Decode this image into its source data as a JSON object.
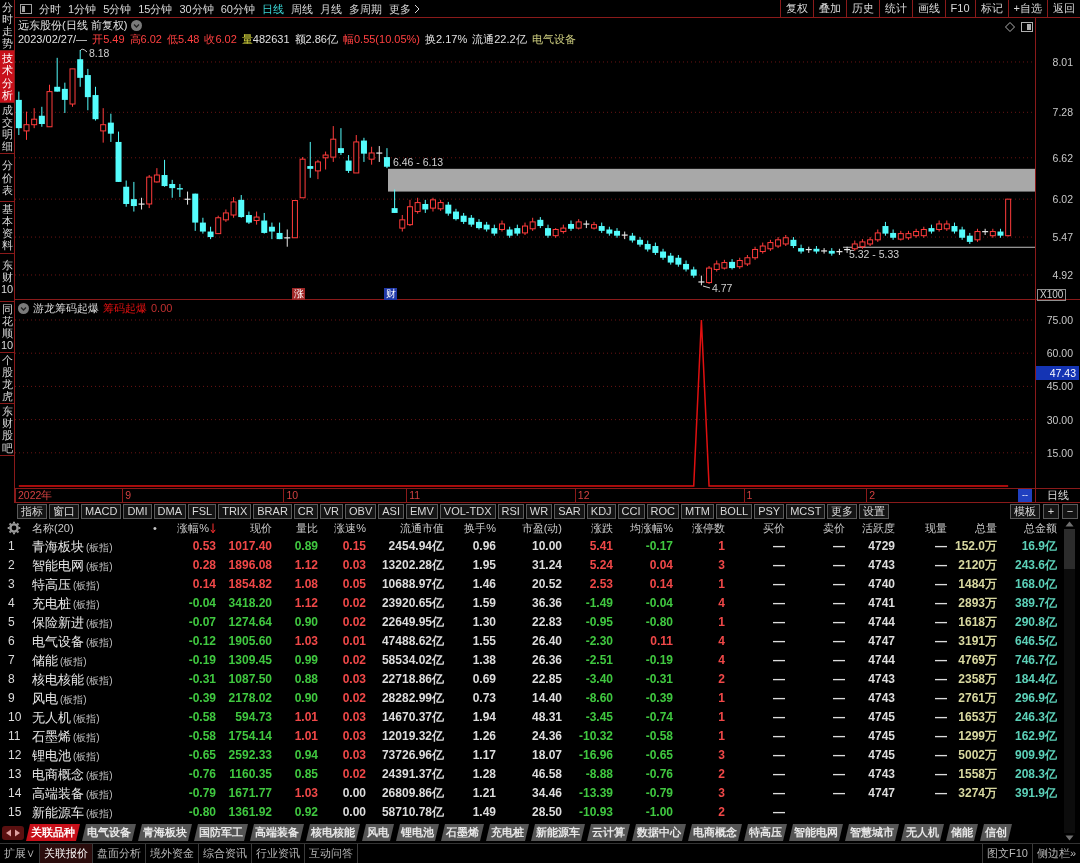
{
  "sidebar": {
    "tabs": [
      {
        "label": "分时走势",
        "selected": false
      },
      {
        "label": "技术分析",
        "selected": true
      },
      {
        "label": "成交明细",
        "selected": false
      },
      {
        "label": "分价表",
        "selected": false
      },
      {
        "label": "基本资料",
        "selected": false
      },
      {
        "label": "东财10",
        "selected": false
      },
      {
        "label": "同花顺10",
        "selected": false
      },
      {
        "label": "个股龙虎",
        "selected": false
      },
      {
        "label": "东财股吧",
        "selected": false
      }
    ]
  },
  "toolbar": {
    "period_tabs": [
      {
        "label": "分时",
        "kind": "period",
        "selected": false
      },
      {
        "label": "1分钟",
        "kind": "period",
        "selected": false
      },
      {
        "label": "5分钟",
        "kind": "period",
        "selected": false
      },
      {
        "label": "15分钟",
        "kind": "period",
        "selected": false
      },
      {
        "label": "30分钟",
        "kind": "period",
        "selected": false
      },
      {
        "label": "60分钟",
        "kind": "period",
        "selected": false
      },
      {
        "label": "日线",
        "kind": "period",
        "selected": true
      },
      {
        "label": "周线",
        "kind": "period",
        "selected": false
      },
      {
        "label": "月线",
        "kind": "period",
        "selected": false
      },
      {
        "label": "多周期",
        "kind": "period",
        "selected": false
      },
      {
        "label": "更多",
        "kind": "menu",
        "selected": false
      }
    ],
    "buttons": [
      "复权",
      "叠加",
      "历史",
      "统计",
      "画线",
      "F10",
      "标记",
      "+自选",
      "返回"
    ]
  },
  "price_chart": {
    "title": "远东股份(日线 前复权)",
    "quote": {
      "date": "2023/02/27/—",
      "fields": [
        {
          "label": "开",
          "value": "5.49",
          "kind": "quote",
          "rising": true
        },
        {
          "label": "高",
          "value": "6.02",
          "kind": "quote",
          "rising": true
        },
        {
          "label": "低",
          "value": "5.48",
          "kind": "quote",
          "rising": true
        },
        {
          "label": "收",
          "value": "6.02",
          "kind": "quote",
          "rising": true
        },
        {
          "label": "量",
          "value": "482631",
          "kind": "volume",
          "rising": false
        },
        {
          "label": "额",
          "value": "2.86亿",
          "kind": "quote",
          "rising": false
        },
        {
          "label": "幅",
          "value": "0.55(10.05%)",
          "kind": "quote",
          "rising": true
        },
        {
          "label": "换",
          "value": "2.17%",
          "kind": "quote",
          "rising": false
        },
        {
          "label": "流通",
          "value": "22.2亿",
          "kind": "quote",
          "rising": false
        }
      ],
      "sector": "电气设备"
    },
    "scale_label": "X100",
    "annotations": [
      {
        "kind": "high",
        "text": "8.18"
      },
      {
        "kind": "low",
        "text": "4.77"
      }
    ],
    "markers": [
      {
        "text": "涨",
        "color": "#a02828"
      },
      {
        "text": "财",
        "color": "#2038a8"
      }
    ],
    "chart_data": {
      "type": "candlestick",
      "ylim": [
        4.557,
        8.648
      ],
      "yticks": [
        {
          "value": 8.01,
          "label": "8.01"
        },
        {
          "value": 7.28,
          "label": "7.28"
        },
        {
          "value": 6.62,
          "label": "6.62"
        },
        {
          "value": 6.02,
          "label": "6.02"
        },
        {
          "value": 5.47,
          "label": "5.47"
        },
        {
          "value": 4.92,
          "label": "4.92"
        }
      ],
      "grid": true,
      "bands": [
        {
          "axis": "y",
          "from": 6.13,
          "to": 6.46,
          "label": "6.46 - 6.13",
          "color": "#a8a8a8"
        },
        {
          "axis": "y",
          "from": 5.32,
          "to": 5.33,
          "label": "5.32 - 5.33",
          "color": "#a0a0a0"
        }
      ],
      "ohlc": [
        [
          7.46,
          7.58,
          6.95,
          7.05
        ],
        [
          7.01,
          7.29,
          6.88,
          7.1
        ],
        [
          7.1,
          7.34,
          7.05,
          7.18
        ],
        [
          7.23,
          7.36,
          7.07,
          7.11
        ],
        [
          7.07,
          7.68,
          7.07,
          7.58
        ],
        [
          7.65,
          8.07,
          7.58,
          7.58
        ],
        [
          7.62,
          7.71,
          7.27,
          7.46
        ],
        [
          7.4,
          7.91,
          7.36,
          7.91
        ],
        [
          8.05,
          8.18,
          7.65,
          7.78
        ],
        [
          7.82,
          7.91,
          7.31,
          7.5
        ],
        [
          7.53,
          7.65,
          7.16,
          7.18
        ],
        [
          7.01,
          7.34,
          6.84,
          7.1
        ],
        [
          7.13,
          7.26,
          6.85,
          6.97
        ],
        [
          6.85,
          7.0,
          6.27,
          6.27
        ],
        [
          6.2,
          6.29,
          5.91,
          5.95
        ],
        [
          6.02,
          6.27,
          5.84,
          5.92
        ],
        [
          5.95,
          6.04,
          5.87,
          5.95
        ],
        [
          5.95,
          6.37,
          5.89,
          6.34
        ],
        [
          6.27,
          6.47,
          6.26,
          6.37
        ],
        [
          6.37,
          6.59,
          6.2,
          6.21
        ],
        [
          6.24,
          6.3,
          6.04,
          6.18
        ],
        [
          6.18,
          6.24,
          6.05,
          6.16
        ],
        [
          6.02,
          6.13,
          5.94,
          6.02
        ],
        [
          6.1,
          6.1,
          5.56,
          5.68
        ],
        [
          5.68,
          5.75,
          5.52,
          5.55
        ],
        [
          5.55,
          5.62,
          5.44,
          5.47
        ],
        [
          5.52,
          5.78,
          5.52,
          5.75
        ],
        [
          5.72,
          5.87,
          5.69,
          5.82
        ],
        [
          5.79,
          6.05,
          5.75,
          5.98
        ],
        [
          6.01,
          6.08,
          5.75,
          5.76
        ],
        [
          5.79,
          5.84,
          5.66,
          5.68
        ],
        [
          5.71,
          5.84,
          5.65,
          5.76
        ],
        [
          5.71,
          5.82,
          5.52,
          5.53
        ],
        [
          5.62,
          5.68,
          5.44,
          5.55
        ],
        [
          5.53,
          5.68,
          5.44,
          5.44
        ],
        [
          5.46,
          5.58,
          5.33,
          5.46
        ],
        [
          5.46,
          6.0,
          5.46,
          6.0
        ],
        [
          6.04,
          6.63,
          6.04,
          6.6
        ],
        [
          6.5,
          6.85,
          6.33,
          6.46
        ],
        [
          6.43,
          6.59,
          6.31,
          6.56
        ],
        [
          6.62,
          6.71,
          6.45,
          6.66
        ],
        [
          6.63,
          7.08,
          6.56,
          6.89
        ],
        [
          6.76,
          7.05,
          6.66,
          6.69
        ],
        [
          6.58,
          6.66,
          6.4,
          6.43
        ],
        [
          6.4,
          6.95,
          6.4,
          6.85
        ],
        [
          6.87,
          6.91,
          6.56,
          6.68
        ],
        [
          6.6,
          6.78,
          6.52,
          6.69
        ],
        [
          6.69,
          6.79,
          6.56,
          6.69
        ],
        [
          6.63,
          6.76,
          6.47,
          6.49
        ],
        [
          5.89,
          6.16,
          5.82,
          5.82
        ],
        [
          5.6,
          5.79,
          5.55,
          5.72
        ],
        [
          5.65,
          6.01,
          5.63,
          5.91
        ],
        [
          5.84,
          6.04,
          5.81,
          5.97
        ],
        [
          5.95,
          6.01,
          5.82,
          5.87
        ],
        [
          5.89,
          6.04,
          5.84,
          6.01
        ],
        [
          5.88,
          6.01,
          5.85,
          5.97
        ],
        [
          5.94,
          5.98,
          5.78,
          5.81
        ],
        [
          5.84,
          5.88,
          5.71,
          5.73
        ],
        [
          5.78,
          5.82,
          5.66,
          5.69
        ],
        [
          5.75,
          5.79,
          5.62,
          5.65
        ],
        [
          5.69,
          5.73,
          5.58,
          5.6
        ],
        [
          5.65,
          5.69,
          5.55,
          5.58
        ],
        [
          5.6,
          5.65,
          5.49,
          5.52
        ],
        [
          5.58,
          5.71,
          5.55,
          5.66
        ],
        [
          5.58,
          5.62,
          5.46,
          5.49
        ],
        [
          5.6,
          5.65,
          5.49,
          5.52
        ],
        [
          5.53,
          5.68,
          5.5,
          5.63
        ],
        [
          5.59,
          5.75,
          5.56,
          5.69
        ],
        [
          5.72,
          5.76,
          5.6,
          5.63
        ],
        [
          5.6,
          5.65,
          5.46,
          5.49
        ],
        [
          5.49,
          5.6,
          5.46,
          5.58
        ],
        [
          5.55,
          5.65,
          5.52,
          5.6
        ],
        [
          5.66,
          5.71,
          5.56,
          5.59
        ],
        [
          5.6,
          5.73,
          5.58,
          5.69
        ],
        [
          5.66,
          5.71,
          5.6,
          5.66
        ],
        [
          5.6,
          5.69,
          5.58,
          5.65
        ],
        [
          5.63,
          5.68,
          5.53,
          5.56
        ],
        [
          5.58,
          5.62,
          5.49,
          5.52
        ],
        [
          5.56,
          5.6,
          5.46,
          5.49
        ],
        [
          5.5,
          5.55,
          5.44,
          5.5
        ],
        [
          5.49,
          5.53,
          5.39,
          5.42
        ],
        [
          5.43,
          5.47,
          5.33,
          5.36
        ],
        [
          5.37,
          5.42,
          5.26,
          5.29
        ],
        [
          5.34,
          5.39,
          5.21,
          5.24
        ],
        [
          5.26,
          5.3,
          5.14,
          5.17
        ],
        [
          5.2,
          5.24,
          5.07,
          5.1
        ],
        [
          5.17,
          5.21,
          5.04,
          5.07
        ],
        [
          5.08,
          5.13,
          4.97,
          5.0
        ],
        [
          5.0,
          5.04,
          4.88,
          4.91
        ],
        [
          4.82,
          4.91,
          4.77,
          4.82
        ],
        [
          4.81,
          5.05,
          4.79,
          5.02
        ],
        [
          5.0,
          5.13,
          4.97,
          5.08
        ],
        [
          5.02,
          5.14,
          5.0,
          5.1
        ],
        [
          5.11,
          5.15,
          5.0,
          5.02
        ],
        [
          5.04,
          5.17,
          5.01,
          5.13
        ],
        [
          5.08,
          5.21,
          5.05,
          5.17
        ],
        [
          5.17,
          5.33,
          5.14,
          5.29
        ],
        [
          5.26,
          5.39,
          5.23,
          5.34
        ],
        [
          5.3,
          5.43,
          5.27,
          5.39
        ],
        [
          5.34,
          5.47,
          5.31,
          5.43
        ],
        [
          5.37,
          5.5,
          5.34,
          5.46
        ],
        [
          5.43,
          5.47,
          5.31,
          5.34
        ],
        [
          5.31,
          5.36,
          5.23,
          5.26
        ],
        [
          5.29,
          5.33,
          5.24,
          5.29
        ],
        [
          5.3,
          5.34,
          5.23,
          5.26
        ],
        [
          5.27,
          5.31,
          5.23,
          5.27
        ],
        [
          5.27,
          5.31,
          5.2,
          5.23
        ],
        [
          5.26,
          5.3,
          5.21,
          5.26
        ],
        [
          5.29,
          5.33,
          5.24,
          5.29
        ],
        [
          5.3,
          5.42,
          5.27,
          5.37
        ],
        [
          5.33,
          5.44,
          5.3,
          5.4
        ],
        [
          5.37,
          5.47,
          5.34,
          5.43
        ],
        [
          5.43,
          5.58,
          5.4,
          5.53
        ],
        [
          5.63,
          5.69,
          5.49,
          5.52
        ],
        [
          5.53,
          5.58,
          5.43,
          5.46
        ],
        [
          5.44,
          5.56,
          5.42,
          5.52
        ],
        [
          5.46,
          5.56,
          5.43,
          5.52
        ],
        [
          5.49,
          5.59,
          5.46,
          5.55
        ],
        [
          5.49,
          5.62,
          5.46,
          5.58
        ],
        [
          5.6,
          5.65,
          5.52,
          5.55
        ],
        [
          5.58,
          5.71,
          5.55,
          5.66
        ],
        [
          5.59,
          5.71,
          5.56,
          5.66
        ],
        [
          5.63,
          5.68,
          5.52,
          5.55
        ],
        [
          5.58,
          5.62,
          5.43,
          5.46
        ],
        [
          5.49,
          5.53,
          5.37,
          5.4
        ],
        [
          5.43,
          5.59,
          5.4,
          5.55
        ],
        [
          5.55,
          5.59,
          5.5,
          5.55
        ],
        [
          5.49,
          5.59,
          5.46,
          5.55
        ],
        [
          5.55,
          5.59,
          5.46,
          5.49
        ],
        [
          5.49,
          6.02,
          5.48,
          6.02
        ],
        null,
        null,
        null
      ]
    }
  },
  "indicator": {
    "value": "0.00",
    "cursor_value": "47.43",
    "chart_data": {
      "type": "line",
      "title": "游龙筹码起爆",
      "series": [
        {
          "name": "筹码起爆",
          "color": "#e01010",
          "values": [
            0,
            0,
            0,
            0,
            0,
            0,
            0,
            0,
            0,
            0,
            0,
            0,
            0,
            0,
            0,
            0,
            0,
            0,
            0,
            0,
            0,
            0,
            0,
            0,
            0,
            0,
            0,
            0,
            0,
            0,
            0,
            0,
            0,
            0,
            0,
            0,
            0,
            0,
            0,
            0,
            0,
            0,
            0,
            0,
            0,
            0,
            0,
            0,
            0,
            0,
            0,
            0,
            0,
            0,
            0,
            0,
            0,
            0,
            0,
            0,
            0,
            0,
            0,
            0,
            0,
            0,
            0,
            0,
            0,
            0,
            0,
            0,
            0,
            0,
            0,
            0,
            0,
            0,
            0,
            0,
            0,
            0,
            0,
            0,
            0,
            0,
            0,
            0,
            0,
            75,
            0,
            0,
            0,
            0,
            0,
            0,
            0,
            0,
            0,
            0,
            0,
            0,
            0,
            0,
            0,
            0,
            0,
            0,
            0,
            0,
            0,
            0,
            0,
            0,
            0,
            0,
            0,
            0,
            0,
            0,
            0,
            0,
            0,
            0,
            0,
            0,
            0,
            0,
            0,
            0,
            null,
            null,
            null
          ]
        }
      ],
      "ylim": [
        -0.9036,
        84.0359
      ],
      "yticks": [
        {
          "value": 15,
          "label": "15.00"
        },
        {
          "value": 30,
          "label": "30.00"
        },
        {
          "value": 45,
          "label": "45.00"
        },
        {
          "value": 60,
          "label": "60.00"
        },
        {
          "value": 75,
          "label": "75.00"
        }
      ],
      "grid": true
    }
  },
  "time_axis": {
    "labels": [
      "2022年",
      "9",
      "10",
      "11",
      "12",
      "1",
      "2"
    ],
    "cursor_date": "--",
    "period": "日线"
  },
  "indicator_tabs": {
    "items": [
      "指标",
      "窗口",
      "MACD",
      "DMI",
      "DMA",
      "FSL",
      "TRIX",
      "BRAR",
      "CR",
      "VR",
      "OBV",
      "ASI",
      "EMV",
      "VOL-TDX",
      "RSI",
      "WR",
      "SAR",
      "KDJ",
      "CCI",
      "ROC",
      "MTM",
      "BOLL",
      "PSY",
      "MCST",
      "更多",
      "设置"
    ],
    "right": [
      "模板",
      "+",
      "−"
    ]
  },
  "table": {
    "columns": [
      {
        "label": "名称(20)",
        "sorted": false
      },
      {
        "label": "•",
        "sorted": false
      },
      {
        "label": "涨幅%",
        "sorted": true
      },
      {
        "label": "现价",
        "sorted": false
      },
      {
        "label": "量比",
        "sorted": false
      },
      {
        "label": "涨速%",
        "sorted": false
      },
      {
        "label": "流通市值",
        "sorted": false
      },
      {
        "label": "换手%",
        "sorted": false
      },
      {
        "label": "市盈(动)",
        "sorted": false
      },
      {
        "label": "涨跌",
        "sorted": false
      },
      {
        "label": "均涨幅%",
        "sorted": false
      },
      {
        "label": "涨停数",
        "sorted": false
      },
      {
        "label": "买价",
        "sorted": false
      },
      {
        "label": "卖价",
        "sorted": false
      },
      {
        "label": "活跃度",
        "sorted": false
      },
      {
        "label": "现量",
        "sorted": false
      },
      {
        "label": "总量",
        "sorted": false
      },
      {
        "label": "总金额",
        "sorted": false
      }
    ],
    "rows": [
      {
        "no": "1",
        "name": "青海板块",
        "tag": "(板指)",
        "chg_pct": "0.53",
        "price": "1017.40",
        "vol_ratio": "0.89",
        "speed": "0.15",
        "float_cap": "2454.94亿",
        "turnover": "0.96",
        "pe": "10.00",
        "chg": "5.41",
        "avg_chg": "-0.17",
        "limit_up": "1",
        "bid": "—",
        "ask": "—",
        "activity": "4729",
        "cur_vol": "—",
        "total_vol": "152.0万",
        "amount": "16.9亿",
        "rising": true,
        "avg_rising": false,
        "ratio_high": false,
        "speed_rising": true
      },
      {
        "no": "2",
        "name": "智能电网",
        "tag": "(板指)",
        "chg_pct": "0.28",
        "price": "1896.08",
        "vol_ratio": "1.12",
        "speed": "0.03",
        "float_cap": "13202.28亿",
        "turnover": "1.95",
        "pe": "31.24",
        "chg": "5.24",
        "avg_chg": "0.04",
        "limit_up": "3",
        "bid": "—",
        "ask": "—",
        "activity": "4743",
        "cur_vol": "—",
        "total_vol": "2120万",
        "amount": "243.6亿",
        "rising": true,
        "avg_rising": true,
        "ratio_high": true,
        "speed_rising": true
      },
      {
        "no": "3",
        "name": "特高压",
        "tag": "(板指)",
        "chg_pct": "0.14",
        "price": "1854.82",
        "vol_ratio": "1.08",
        "speed": "0.05",
        "float_cap": "10688.97亿",
        "turnover": "1.46",
        "pe": "20.52",
        "chg": "2.53",
        "avg_chg": "0.14",
        "limit_up": "1",
        "bid": "—",
        "ask": "—",
        "activity": "4740",
        "cur_vol": "—",
        "total_vol": "1484万",
        "amount": "168.0亿",
        "rising": true,
        "avg_rising": true,
        "ratio_high": true,
        "speed_rising": true
      },
      {
        "no": "4",
        "name": "充电桩",
        "tag": "(板指)",
        "chg_pct": "-0.04",
        "price": "3418.20",
        "vol_ratio": "1.12",
        "speed": "0.02",
        "float_cap": "23920.65亿",
        "turnover": "1.59",
        "pe": "36.36",
        "chg": "-1.49",
        "avg_chg": "-0.04",
        "limit_up": "4",
        "bid": "—",
        "ask": "—",
        "activity": "4741",
        "cur_vol": "—",
        "total_vol": "2893万",
        "amount": "389.7亿",
        "rising": false,
        "avg_rising": false,
        "ratio_high": true,
        "speed_rising": true
      },
      {
        "no": "5",
        "name": "保险新进",
        "tag": "(板指)",
        "chg_pct": "-0.07",
        "price": "1274.64",
        "vol_ratio": "0.90",
        "speed": "0.02",
        "float_cap": "22649.95亿",
        "turnover": "1.30",
        "pe": "22.83",
        "chg": "-0.95",
        "avg_chg": "-0.80",
        "limit_up": "1",
        "bid": "—",
        "ask": "—",
        "activity": "4744",
        "cur_vol": "—",
        "total_vol": "1618万",
        "amount": "290.8亿",
        "rising": false,
        "avg_rising": false,
        "ratio_high": false,
        "speed_rising": true
      },
      {
        "no": "6",
        "name": "电气设备",
        "tag": "(板指)",
        "chg_pct": "-0.12",
        "price": "1905.60",
        "vol_ratio": "1.03",
        "speed": "0.01",
        "float_cap": "47488.62亿",
        "turnover": "1.55",
        "pe": "26.40",
        "chg": "-2.30",
        "avg_chg": "0.11",
        "limit_up": "4",
        "bid": "—",
        "ask": "—",
        "activity": "4747",
        "cur_vol": "—",
        "total_vol": "3191万",
        "amount": "646.5亿",
        "rising": false,
        "avg_rising": true,
        "ratio_high": true,
        "speed_rising": true
      },
      {
        "no": "7",
        "name": "储能",
        "tag": "(板指)",
        "chg_pct": "-0.19",
        "price": "1309.45",
        "vol_ratio": "0.99",
        "speed": "0.02",
        "float_cap": "58534.02亿",
        "turnover": "1.38",
        "pe": "26.36",
        "chg": "-2.51",
        "avg_chg": "-0.19",
        "limit_up": "4",
        "bid": "—",
        "ask": "—",
        "activity": "4744",
        "cur_vol": "—",
        "total_vol": "4769万",
        "amount": "746.7亿",
        "rising": false,
        "avg_rising": false,
        "ratio_high": false,
        "speed_rising": true
      },
      {
        "no": "8",
        "name": "核电核能",
        "tag": "(板指)",
        "chg_pct": "-0.31",
        "price": "1087.50",
        "vol_ratio": "0.88",
        "speed": "0.03",
        "float_cap": "22718.86亿",
        "turnover": "0.69",
        "pe": "22.85",
        "chg": "-3.40",
        "avg_chg": "-0.31",
        "limit_up": "2",
        "bid": "—",
        "ask": "—",
        "activity": "4743",
        "cur_vol": "—",
        "total_vol": "2358万",
        "amount": "184.4亿",
        "rising": false,
        "avg_rising": false,
        "ratio_high": false,
        "speed_rising": true
      },
      {
        "no": "9",
        "name": "风电",
        "tag": "(板指)",
        "chg_pct": "-0.39",
        "price": "2178.02",
        "vol_ratio": "0.90",
        "speed": "0.02",
        "float_cap": "28282.99亿",
        "turnover": "0.73",
        "pe": "14.40",
        "chg": "-8.60",
        "avg_chg": "-0.39",
        "limit_up": "1",
        "bid": "—",
        "ask": "—",
        "activity": "4743",
        "cur_vol": "—",
        "total_vol": "2761万",
        "amount": "296.9亿",
        "rising": false,
        "avg_rising": false,
        "ratio_high": false,
        "speed_rising": true
      },
      {
        "no": "10",
        "name": "无人机",
        "tag": "(板指)",
        "chg_pct": "-0.58",
        "price": "594.73",
        "vol_ratio": "1.01",
        "speed": "0.03",
        "float_cap": "14670.37亿",
        "turnover": "1.94",
        "pe": "48.31",
        "chg": "-3.45",
        "avg_chg": "-0.74",
        "limit_up": "1",
        "bid": "—",
        "ask": "—",
        "activity": "4745",
        "cur_vol": "—",
        "total_vol": "1653万",
        "amount": "246.3亿",
        "rising": false,
        "avg_rising": false,
        "ratio_high": true,
        "speed_rising": true
      },
      {
        "no": "11",
        "name": "石墨烯",
        "tag": "(板指)",
        "chg_pct": "-0.58",
        "price": "1754.14",
        "vol_ratio": "1.01",
        "speed": "0.03",
        "float_cap": "12019.32亿",
        "turnover": "1.26",
        "pe": "24.36",
        "chg": "-10.32",
        "avg_chg": "-0.58",
        "limit_up": "1",
        "bid": "—",
        "ask": "—",
        "activity": "4745",
        "cur_vol": "—",
        "total_vol": "1299万",
        "amount": "162.9亿",
        "rising": false,
        "avg_rising": false,
        "ratio_high": true,
        "speed_rising": true
      },
      {
        "no": "12",
        "name": "锂电池",
        "tag": "(板指)",
        "chg_pct": "-0.65",
        "price": "2592.33",
        "vol_ratio": "0.94",
        "speed": "0.03",
        "float_cap": "73726.96亿",
        "turnover": "1.17",
        "pe": "18.07",
        "chg": "-16.96",
        "avg_chg": "-0.65",
        "limit_up": "3",
        "bid": "—",
        "ask": "—",
        "activity": "4745",
        "cur_vol": "—",
        "total_vol": "5002万",
        "amount": "909.9亿",
        "rising": false,
        "avg_rising": false,
        "ratio_high": false,
        "speed_rising": true
      },
      {
        "no": "13",
        "name": "电商概念",
        "tag": "(板指)",
        "chg_pct": "-0.76",
        "price": "1160.35",
        "vol_ratio": "0.85",
        "speed": "0.02",
        "float_cap": "24391.37亿",
        "turnover": "1.28",
        "pe": "46.58",
        "chg": "-8.88",
        "avg_chg": "-0.76",
        "limit_up": "2",
        "bid": "—",
        "ask": "—",
        "activity": "4743",
        "cur_vol": "—",
        "total_vol": "1558万",
        "amount": "208.3亿",
        "rising": false,
        "avg_rising": false,
        "ratio_high": false,
        "speed_rising": true
      },
      {
        "no": "14",
        "name": "高端装备",
        "tag": "(板指)",
        "chg_pct": "-0.79",
        "price": "1671.77",
        "vol_ratio": "1.03",
        "speed": "0.00",
        "float_cap": "26809.86亿",
        "turnover": "1.21",
        "pe": "34.46",
        "chg": "-13.39",
        "avg_chg": "-0.79",
        "limit_up": "3",
        "bid": "—",
        "ask": "—",
        "activity": "4747",
        "cur_vol": "—",
        "total_vol": "3274万",
        "amount": "391.9亿",
        "rising": false,
        "avg_rising": false,
        "ratio_high": true,
        "speed_rising": false
      },
      {
        "no": "15",
        "name": "新能源车",
        "tag": "(板指)",
        "chg_pct": "-0.80",
        "price": "1361.92",
        "vol_ratio": "0.92",
        "speed": "0.00",
        "float_cap": "58710.78亿",
        "turnover": "1.49",
        "pe": "28.50",
        "chg": "-10.93",
        "avg_chg": "-1.00",
        "limit_up": "2",
        "bid": "—",
        "rising": false,
        "avg_rising": false,
        "ratio_high": false,
        "speed_rising": false
      }
    ]
  },
  "related_tabs": [
    {
      "label": "关联品种",
      "selected": true
    },
    {
      "label": "电气设备",
      "selected": false
    },
    {
      "label": "青海板块",
      "selected": false
    },
    {
      "label": "国防军工",
      "selected": false
    },
    {
      "label": "高端装备",
      "selected": false
    },
    {
      "label": "核电核能",
      "selected": false
    },
    {
      "label": "风电",
      "selected": false
    },
    {
      "label": "锂电池",
      "selected": false
    },
    {
      "label": "石墨烯",
      "selected": false
    },
    {
      "label": "充电桩",
      "selected": false
    },
    {
      "label": "新能源车",
      "selected": false
    },
    {
      "label": "云计算",
      "selected": false
    },
    {
      "label": "数据中心",
      "selected": false
    },
    {
      "label": "电商概念",
      "selected": false
    },
    {
      "label": "特高压",
      "selected": false
    },
    {
      "label": "智能电网",
      "selected": false
    },
    {
      "label": "智慧城市",
      "selected": false
    },
    {
      "label": "无人机",
      "selected": false
    },
    {
      "label": "储能",
      "selected": false
    },
    {
      "label": "信创",
      "selected": false
    }
  ],
  "footer": {
    "tabs": [
      {
        "label": "扩展∨",
        "selected": false
      },
      {
        "label": "关联报价",
        "selected": true
      },
      {
        "label": "盘面分析",
        "selected": false
      },
      {
        "label": "境外资金",
        "selected": false
      },
      {
        "label": "综合资讯",
        "selected": false
      },
      {
        "label": "行业资讯",
        "selected": false
      },
      {
        "label": "互动问答",
        "selected": false
      }
    ],
    "right": [
      "图文F10",
      "侧边栏»"
    ]
  }
}
